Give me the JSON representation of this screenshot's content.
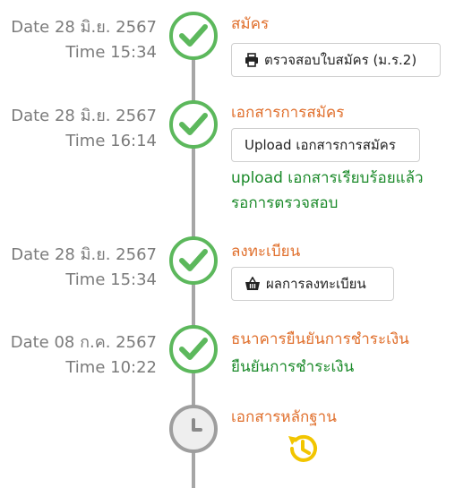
{
  "steps": [
    {
      "date": "Date 28 มิ.ย. 2567",
      "time": "Time 15:34",
      "title": "สมัคร",
      "status": "done",
      "button": {
        "label": "ตรวจสอบใบสมัคร (ม.ร.2)",
        "icon": "printer-icon"
      }
    },
    {
      "date": "Date 28 มิ.ย. 2567",
      "time": "Time 16:14",
      "title": "เอกสารการสมัคร",
      "status": "done",
      "button": {
        "label": "Upload เอกสารการสมัคร"
      },
      "note_line1": "upload เอกสารเรียบร้อยแล้ว",
      "note_line2": "รอการตรวจสอบ"
    },
    {
      "date": "Date 28 มิ.ย. 2567",
      "time": "Time 15:34",
      "title": "ลงทะเบียน",
      "status": "done",
      "button": {
        "label": "ผลการลงทะเบียน",
        "icon": "basket-icon"
      }
    },
    {
      "date": "Date 08 ก.ค. 2567",
      "time": "Time 10:22",
      "title": "ธนาคารยืนยันการชำระเงิน",
      "status": "done",
      "note_line1": "ยืนยันการชำระเงิน"
    },
    {
      "title": "เอกสารหลักฐาน",
      "status": "pending",
      "pending_icon": "history-icon"
    }
  ],
  "colors": {
    "done": "#5cb85c",
    "pending": "#9e9e9e",
    "title": "#e06f2c",
    "note": "#1b8a2a",
    "history": "#f2c500"
  }
}
